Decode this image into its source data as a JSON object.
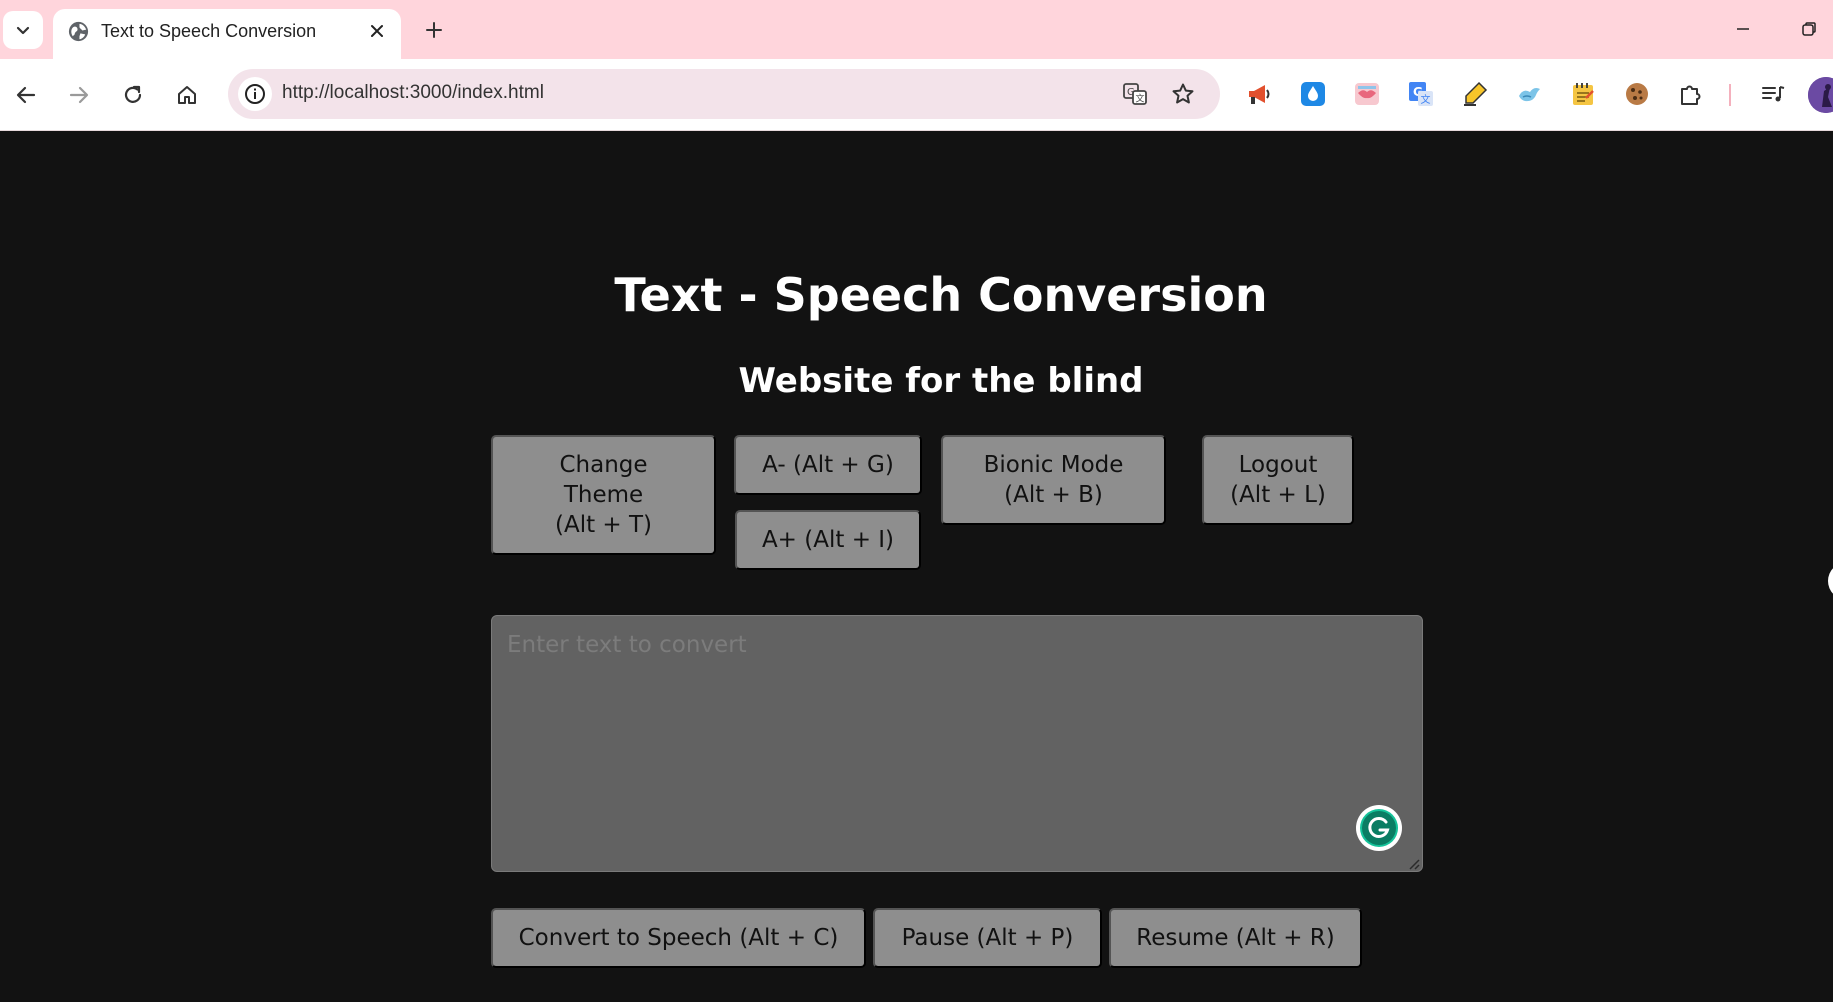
{
  "browser": {
    "tab": {
      "title": "Text to Speech Conversion",
      "favicon": "globe-icon"
    },
    "address_bar": {
      "url": "http://localhost:3000/index.html"
    },
    "extensions": [
      "megaphone-icon",
      "water-drop-icon",
      "lips-icon",
      "google-translate-icon",
      "highlighter-icon",
      "bird-icon",
      "notepad-icon",
      "cookie-icon",
      "puzzle-icon"
    ],
    "colors": {
      "tabstrip": "#ffd5dc",
      "toolbar": "#ffffff",
      "omnibox": "#f3e3ea"
    }
  },
  "page": {
    "title": "Text - Speech Conversion",
    "subtitle": "Website for the blind",
    "controls": {
      "change_theme": "Change\nTheme\n(Alt + T)",
      "font_decrease": "A- (Alt + G)",
      "font_increase": "A+ (Alt + I)",
      "bionic_mode": "Bionic Mode\n(Alt + B)",
      "logout": "Logout\n(Alt + L)"
    },
    "text_input": {
      "placeholder": "Enter text to convert",
      "value": ""
    },
    "actions": {
      "convert": "Convert to Speech (Alt + C)",
      "pause": "Pause (Alt + P)",
      "resume": "Resume (Alt + R)"
    },
    "colors": {
      "background": "#121212",
      "button": "#8e8e8e",
      "text_area": "#626262",
      "heading": "#ffffff"
    }
  }
}
